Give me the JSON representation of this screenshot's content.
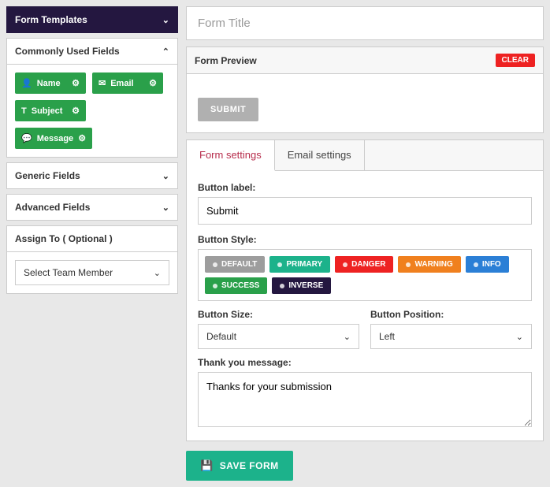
{
  "sidebar": {
    "templates_header": "Form Templates",
    "common_header": "Commonly Used Fields",
    "common_fields": [
      {
        "icon": "👤",
        "label": "Name"
      },
      {
        "icon": "✉",
        "label": "Email"
      },
      {
        "icon": "T",
        "label": "Subject"
      },
      {
        "icon": "💬",
        "label": "Message"
      }
    ],
    "generic_header": "Generic Fields",
    "advanced_header": "Advanced Fields",
    "assign_header": "Assign To ( Optional )",
    "assign_placeholder": "Select Team Member"
  },
  "main": {
    "title_placeholder": "Form Title",
    "preview_header": "Form Preview",
    "clear_label": "CLEAR",
    "submit_preview_label": "SUBMIT",
    "tabs": {
      "form": "Form settings",
      "email": "Email settings"
    },
    "form_settings": {
      "button_label_lbl": "Button label:",
      "button_label_val": "Submit",
      "button_style_lbl": "Button Style:",
      "styles": [
        {
          "cls": "sb-default",
          "label": "DEFAULT"
        },
        {
          "cls": "sb-primary",
          "label": "PRIMARY"
        },
        {
          "cls": "sb-danger",
          "label": "DANGER"
        },
        {
          "cls": "sb-warning",
          "label": "WARNING"
        },
        {
          "cls": "sb-info",
          "label": "INFO"
        },
        {
          "cls": "sb-success",
          "label": "SUCCESS"
        },
        {
          "cls": "sb-inverse",
          "label": "INVERSE"
        }
      ],
      "button_size_lbl": "Button Size:",
      "button_size_val": "Default",
      "button_pos_lbl": "Button Position:",
      "button_pos_val": "Left",
      "thank_lbl": "Thank you message:",
      "thank_val": "Thanks for your submission"
    },
    "save_label": "SAVE FORM"
  }
}
